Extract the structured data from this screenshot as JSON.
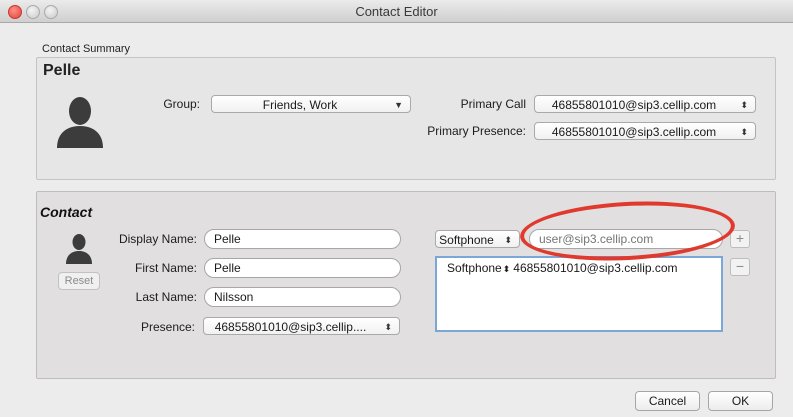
{
  "window": {
    "title": "Contact Editor"
  },
  "summary": {
    "section_label": "Contact Summary",
    "name": "Pelle",
    "group_label": "Group:",
    "group_value": "Friends, Work",
    "primary_call_label": "Primary Call",
    "primary_call_value": "46855801010@sip3.cellip.com",
    "primary_presence_label": "Primary Presence:",
    "primary_presence_value": "46855801010@sip3.cellip.com"
  },
  "contact": {
    "section_label": "Contact",
    "reset_label": "Reset",
    "display_name_label": "Display Name:",
    "display_name_value": "Pelle",
    "first_name_label": "First Name:",
    "first_name_value": "Pelle",
    "last_name_label": "Last Name:",
    "last_name_value": "Nilsson",
    "presence_label": "Presence:",
    "presence_value": "46855801010@sip3.cellip....",
    "new_address_type": "Softphone",
    "new_address_placeholder": "user@sip3.cellip.com",
    "add_label": "+",
    "remove_label": "−",
    "addresses": [
      {
        "type": "Softphone",
        "address": "46855801010@sip3.cellip.com"
      }
    ]
  },
  "footer": {
    "cancel_label": "Cancel",
    "ok_label": "OK"
  },
  "colors": {
    "highlight_ring": "#e0392d",
    "focus_border": "#7aa7d8"
  },
  "icons": {
    "contact_large": "person-silhouette-icon",
    "contact_small": "person-silhouette-icon"
  }
}
